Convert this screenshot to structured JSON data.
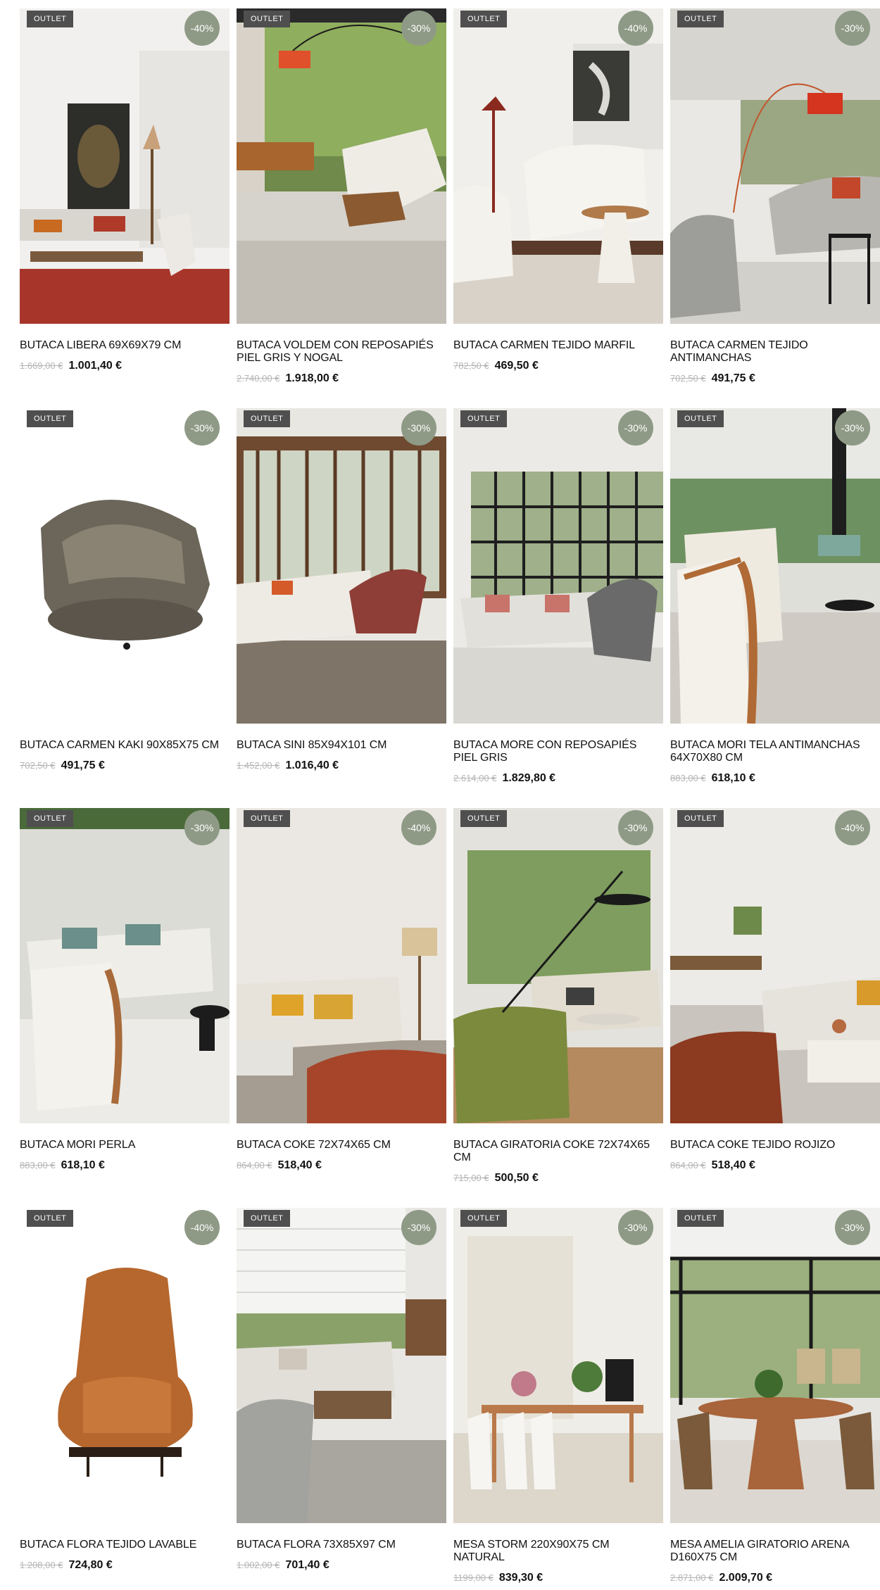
{
  "outlet_label": "OUTLET",
  "products": [
    {
      "name": "BUTACA LIBERA 69X69X79 CM",
      "old_price": "1.669,00 €",
      "price": "1.001,40 €",
      "discount": "-40%"
    },
    {
      "name": "BUTACA VOLDEM CON REPOSAPIÉS PIEL GRIS Y NOGAL",
      "old_price": "2.740,00 €",
      "price": "1.918,00 €",
      "discount": "-30%"
    },
    {
      "name": "BUTACA CARMEN TEJIDO MARFIL",
      "old_price": "782,50 €",
      "price": "469,50 €",
      "discount": "-40%"
    },
    {
      "name": "BUTACA CARMEN TEJIDO ANTIMANCHAS",
      "old_price": "702,50 €",
      "price": "491,75 €",
      "discount": "-30%"
    },
    {
      "name": "BUTACA CARMEN KAKI 90X85X75 CM",
      "old_price": "702,50 €",
      "price": "491,75 €",
      "discount": "-30%"
    },
    {
      "name": "BUTACA SINI 85X94X101 CM",
      "old_price": "1.452,00 €",
      "price": "1.016,40 €",
      "discount": "-30%"
    },
    {
      "name": "BUTACA MORE CON REPOSAPIÉS PIEL GRIS",
      "old_price": "2.614,00 €",
      "price": "1.829,80 €",
      "discount": "-30%"
    },
    {
      "name": "BUTACA MORI TELA ANTIMANCHAS 64X70X80 CM",
      "old_price": "883,00 €",
      "price": "618,10 €",
      "discount": "-30%"
    },
    {
      "name": "BUTACA MORI PERLA",
      "old_price": "883,00 €",
      "price": "618,10 €",
      "discount": "-30%"
    },
    {
      "name": "BUTACA COKE 72X74X65 CM",
      "old_price": "864,00 €",
      "price": "518,40 €",
      "discount": "-40%"
    },
    {
      "name": "BUTACA GIRATORIA COKE 72X74X65 CM",
      "old_price": "715,00 €",
      "price": "500,50 €",
      "discount": "-30%"
    },
    {
      "name": "BUTACA COKE TEJIDO ROJIZO",
      "old_price": "864,00 €",
      "price": "518,40 €",
      "discount": "-40%"
    },
    {
      "name": "BUTACA FLORA TEJIDO LAVABLE",
      "old_price": "1.208,00 €",
      "price": "724,80 €",
      "discount": "-40%"
    },
    {
      "name": "BUTACA FLORA 73X85X97 CM",
      "old_price": "1.002,00 €",
      "price": "701,40 €",
      "discount": "-30%"
    },
    {
      "name": "MESA STORM 220X90X75 CM NATURAL",
      "old_price": "1199,00 €",
      "price": "839,30 €",
      "discount": "-30%"
    },
    {
      "name": "MESA AMELIA GIRATORIO ARENA D160X75 CM",
      "old_price": "2.871,00 €",
      "price": "2.009,70 €",
      "discount": "-30%"
    }
  ],
  "colors": {
    "outlet_badge": "#4f4f4f",
    "discount_badge": "#8e9a86",
    "old_price": "#b5b5b5"
  }
}
